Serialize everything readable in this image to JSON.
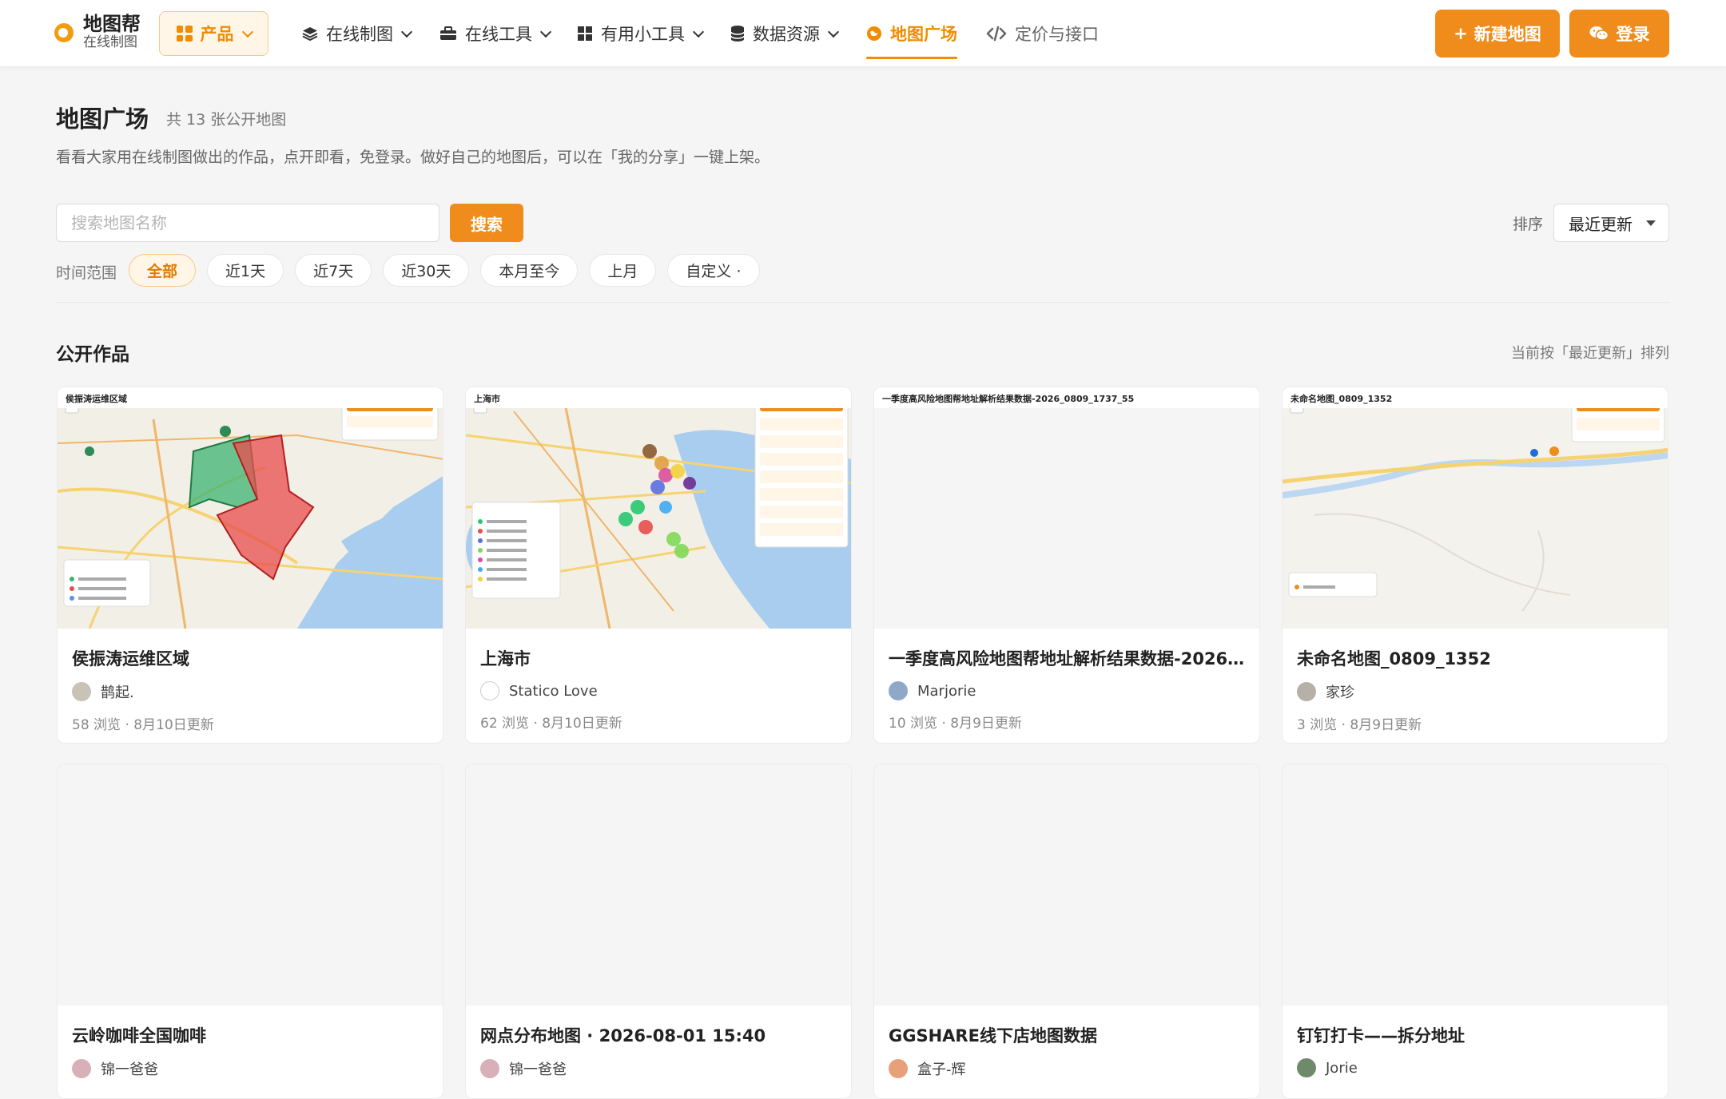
{
  "brand": {
    "title": "地图帮",
    "subtitle": "在线制图"
  },
  "nav": {
    "product": "产品",
    "items": [
      {
        "label": "在线制图",
        "icon": "layers-icon"
      },
      {
        "label": "在线工具",
        "icon": "toolbox-icon"
      },
      {
        "label": "有用小工具",
        "icon": "grid-icon"
      },
      {
        "label": "数据资源",
        "icon": "database-icon"
      },
      {
        "label": "地图广场",
        "icon": "globe-icon"
      },
      {
        "label": "定价与接口",
        "icon": "code-icon"
      }
    ],
    "new_map": "新建地图",
    "login": "登录"
  },
  "page": {
    "title": "地图广场",
    "count": "共 13 张公开地图",
    "description": "看看大家用在线制图做出的作品，点开即看，免登录。做好自己的地图后，可以在「我的分享」一键上架。"
  },
  "search": {
    "placeholder": "搜索地图名称",
    "button": "搜索"
  },
  "sort": {
    "label": "排序",
    "selected": "最近更新"
  },
  "time_filter": {
    "label": "时间范围",
    "options": [
      "全部",
      "近1天",
      "近7天",
      "近30天",
      "本月至今",
      "上月",
      "自定义 ·"
    ]
  },
  "section": {
    "title": "公开作品",
    "note": "当前按「最近更新」排列"
  },
  "cards": [
    {
      "title": "侯振涛运维区域",
      "thumb_label": "侯振涛运维区域",
      "author": "鹊起.",
      "meta": "58 浏览 · 8月10日更新"
    },
    {
      "title": "上海市",
      "thumb_label": "上海市",
      "author": "Statico Love",
      "meta": "62 浏览 · 8月10日更新"
    },
    {
      "title": "一季度高风险地图帮地址解析结果数据-2026...",
      "thumb_label": "一季度高风险地图帮地址解析结果数据-2026_0809_1737_55",
      "author": "Marjorie",
      "meta": "10 浏览 · 8月9日更新"
    },
    {
      "title": "未命名地图_0809_1352",
      "thumb_label": "未命名地图_0809_1352",
      "author": "家珍",
      "meta": "3 浏览 · 8月9日更新"
    },
    {
      "title": "云岭咖啡全国咖啡",
      "author": "锦一爸爸"
    },
    {
      "title": "网点分布地图 · 2026-08-01 15:40",
      "author": "锦一爸爸"
    },
    {
      "title": "GGSHARE线下店地图数据",
      "author": "盒子-辉"
    },
    {
      "title": "钉钉打卡——拆分地址",
      "author": "Jorie"
    }
  ]
}
